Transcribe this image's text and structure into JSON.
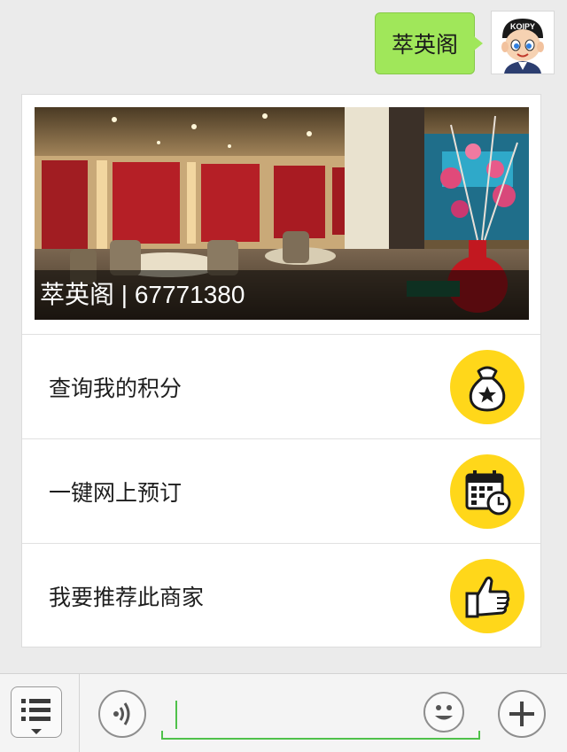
{
  "chat": {
    "sent_message": "萃英阁",
    "avatar_badge": "KOIPY"
  },
  "card": {
    "cover_caption": "萃英阁 | 67771380",
    "menu_items": [
      {
        "label": "查询我的积分",
        "icon": "money-bag-star-icon"
      },
      {
        "label": "一键网上预订",
        "icon": "calendar-clock-icon"
      },
      {
        "label": "我要推荐此商家",
        "icon": "thumbs-up-icon"
      }
    ],
    "accent_color": "#ffd71a"
  },
  "bottom_bar": {
    "menu_icon": "menu-list-icon",
    "voice_icon": "voice-icon",
    "emoji_icon": "emoji-icon",
    "plus_icon": "plus-icon",
    "input_value": ""
  }
}
